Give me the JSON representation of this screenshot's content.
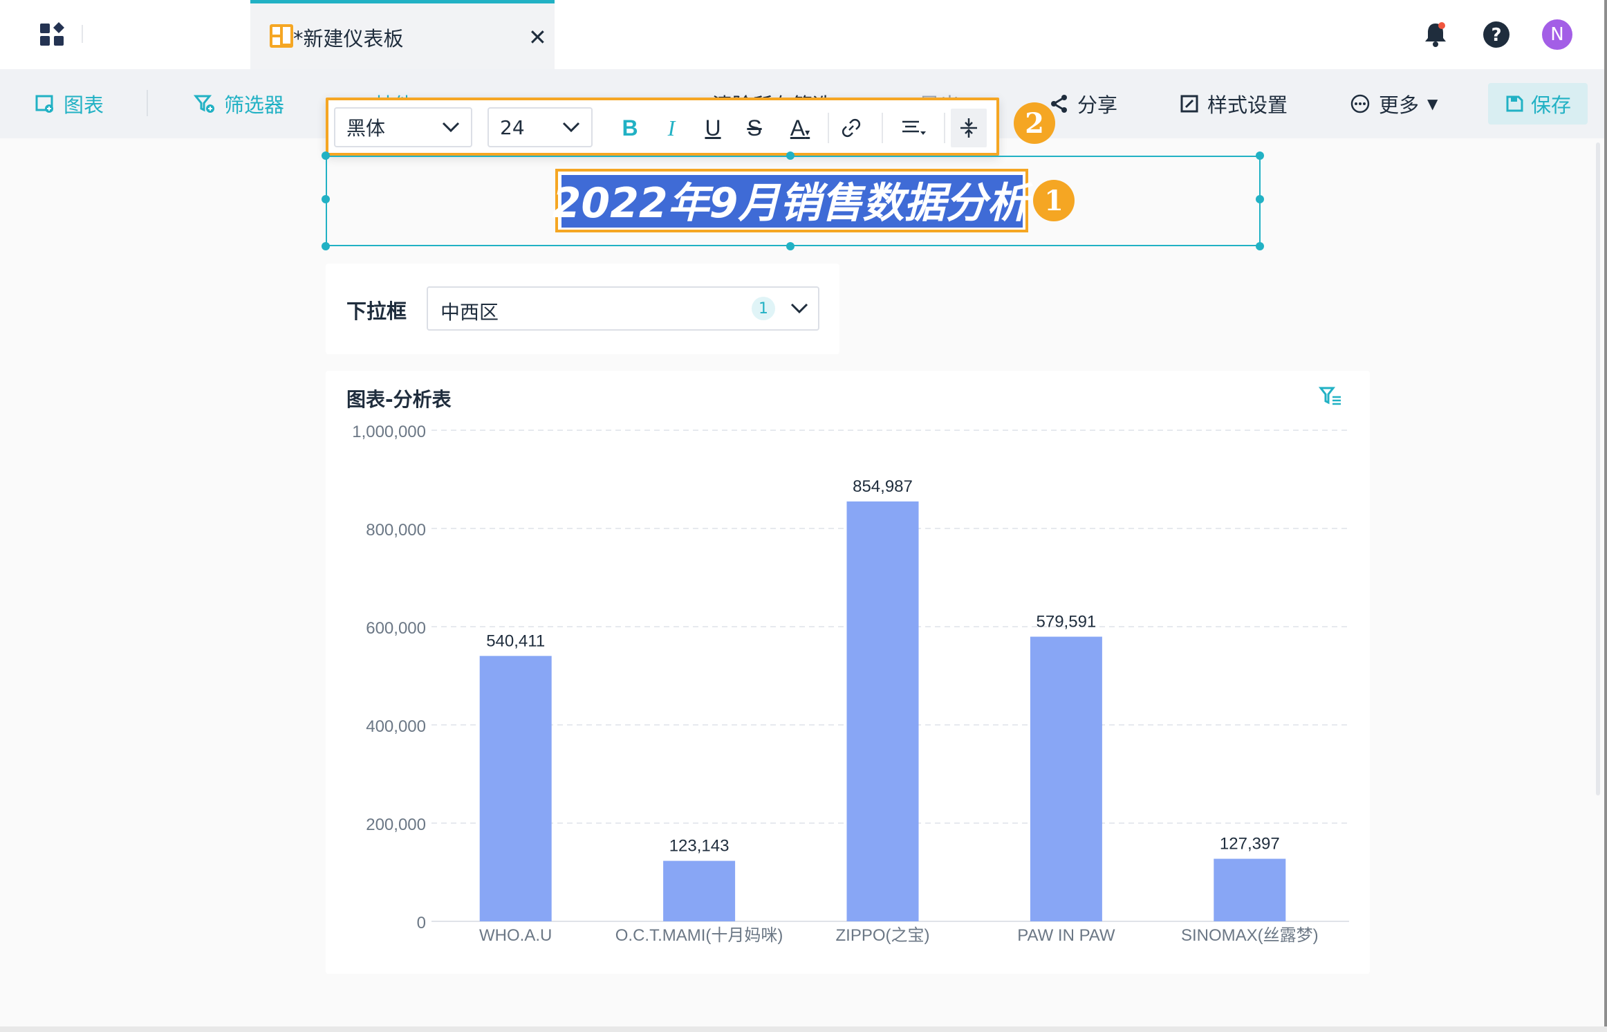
{
  "header": {
    "tab_label": "*新建仪表板",
    "icons": [
      "apps-icon",
      "bell-icon",
      "help-icon",
      "avatar"
    ],
    "avatar_initial": "N",
    "accent_color": "#21b1c4"
  },
  "toolbar": {
    "chart_label": "图表",
    "filter_label": "筛选器",
    "other_label": "其他",
    "clear_filters_label": "清除所有筛选",
    "export_label": "导出",
    "share_label": "分享",
    "style_label": "样式设置",
    "more_label": "更多",
    "save_label": "保存"
  },
  "rich_text_toolbar": {
    "font": "黑体",
    "size": "24",
    "buttons": [
      "bold",
      "italic",
      "underline",
      "strikethrough",
      "font-color",
      "link",
      "align",
      "line-spacing"
    ]
  },
  "annotations": {
    "one": "1",
    "two": "2"
  },
  "title": {
    "text": "2022年9月销售数据分析"
  },
  "filter": {
    "label": "下拉框",
    "value": "中西区",
    "count": "1"
  },
  "chart": {
    "title": "图表-分析表",
    "bar_color": "#88a6f5"
  },
  "chart_data": {
    "type": "bar",
    "categories": [
      "WHO.A.U",
      "O.C.T.MAMI(十月妈咪)",
      "ZIPPO(之宝)",
      "PAW IN PAW",
      "SINOMAX(丝露梦)"
    ],
    "values": [
      540411,
      123143,
      854987,
      579591,
      127397
    ],
    "value_labels": [
      "540,411",
      "123,143",
      "854,987",
      "579,591",
      "127,397"
    ],
    "y_ticks": [
      0,
      200000,
      400000,
      600000,
      800000,
      1000000
    ],
    "y_tick_labels": [
      "0",
      "200,000",
      "400,000",
      "600,000",
      "800,000",
      "1,000,000"
    ],
    "ylim": [
      0,
      1000000
    ],
    "grid": true,
    "title": "图表-分析表",
    "xlabel": "",
    "ylabel": ""
  }
}
